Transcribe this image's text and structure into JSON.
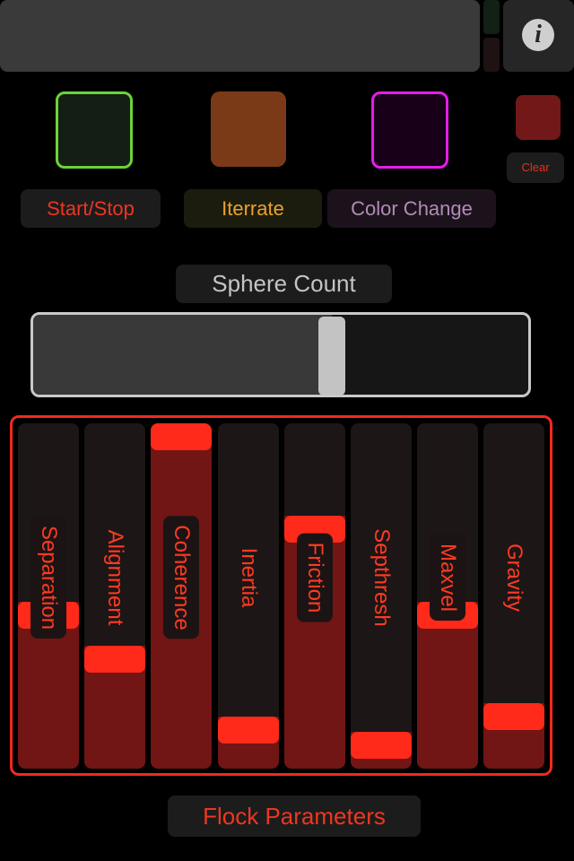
{
  "display": {},
  "info_button": {
    "icon": "info-icon",
    "glyph": "i"
  },
  "pads": {
    "green": {
      "color": "#6cd23a"
    },
    "orange": {
      "color": "#7b3a17"
    },
    "magenta": {
      "color": "#e41ee7"
    },
    "red": {
      "color": "#731818"
    }
  },
  "buttons": {
    "clear": "Clear",
    "start_stop": "Start/Stop",
    "iterate": "Iterrate",
    "color_change": "Color Change"
  },
  "sphere_count": {
    "label": "Sphere Count",
    "value_fraction": 0.61
  },
  "flock": {
    "label": "Flock Parameters",
    "accent": "#f02a1e",
    "faders": [
      {
        "label": "Separation",
        "level": 0.44
      },
      {
        "label": "Alignment",
        "level": 0.3
      },
      {
        "label": "Coherence",
        "level": 1.0
      },
      {
        "label": "Inertia",
        "level": 0.08
      },
      {
        "label": "Friction",
        "level": 0.71
      },
      {
        "label": "Septhresh",
        "level": 0.03
      },
      {
        "label": "Maxvel",
        "level": 0.44
      },
      {
        "label": "Gravity",
        "level": 0.12
      }
    ]
  }
}
